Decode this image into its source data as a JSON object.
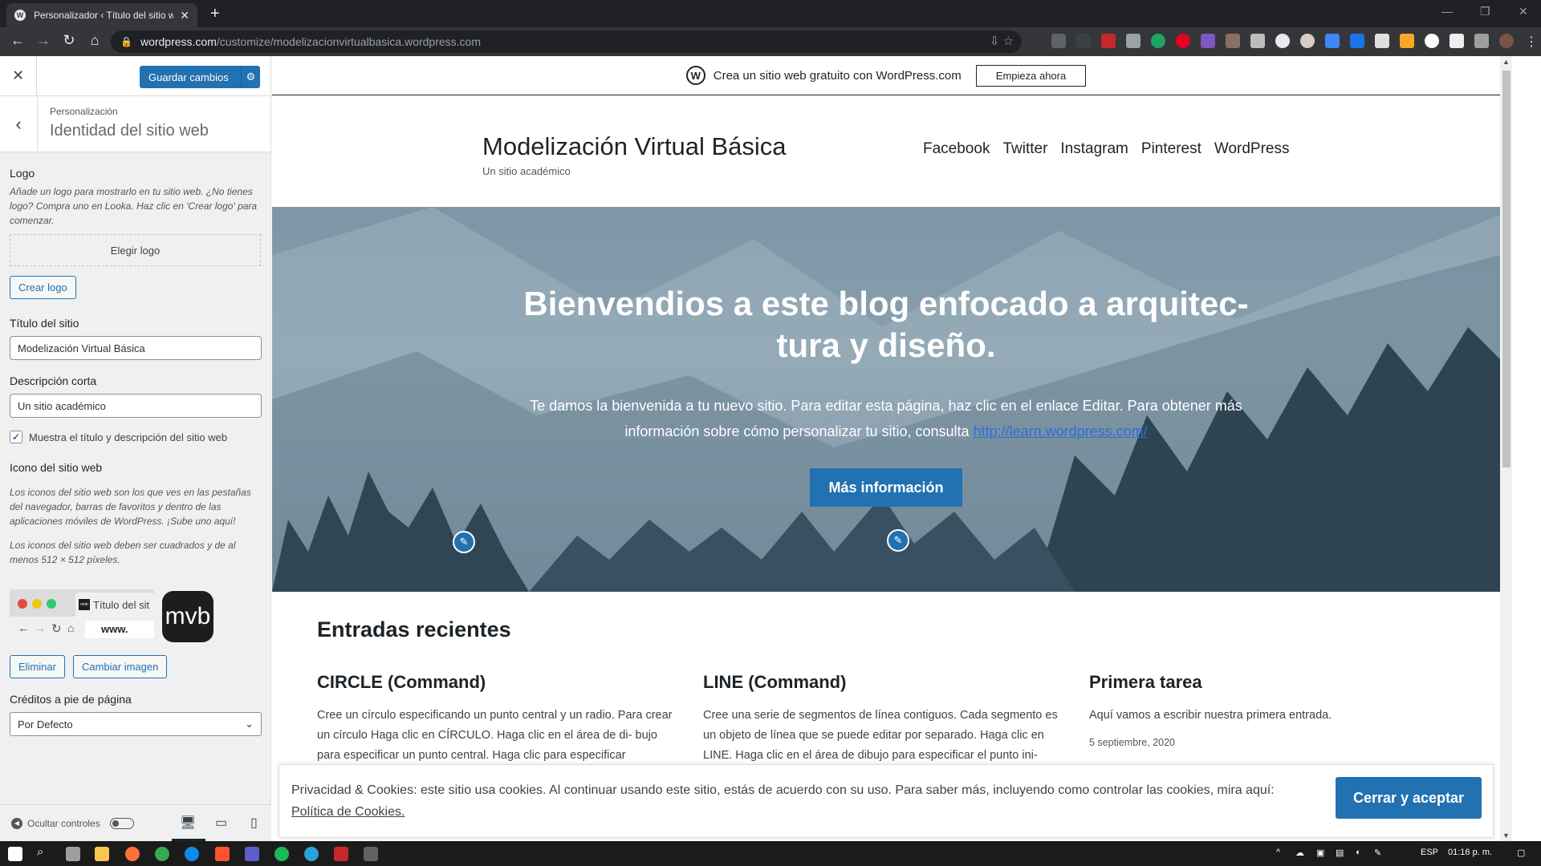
{
  "browser": {
    "tab_title": "Personalizador ‹ Título del sitio w",
    "tab_close": "✕",
    "new_tab": "+",
    "minimize": "—",
    "restore": "❐",
    "close": "✕",
    "url_host": "wordpress.com",
    "url_path": "/customize/modelizacionvirtualbasica.wordpress.com"
  },
  "customizer": {
    "close": "✕",
    "save_label": "Guardar cambios",
    "breadcrumb": "Personalización",
    "section_title": "Identidad del sitio web",
    "logo": {
      "label": "Logo",
      "description": "Añade un logo para mostrarlo en tu sitio web. ¿No tienes logo? Compra uno en Looka. Haz clic en 'Crear logo' para comenzar.",
      "choose": "Elegir logo",
      "create": "Crear logo"
    },
    "site_title": {
      "label": "Título del sitio",
      "value": "Modelización Virtual Básica"
    },
    "tagline": {
      "label": "Descripción corta",
      "value": "Un sitio académico"
    },
    "show_title_label": "Muestra el título y descripción del sitio web",
    "site_icon": {
      "label": "Icono del sitio web",
      "description1": "Los iconos del sitio web son los que ves en las pestañas del navegador, barras de favoritos y dentro de las aplicaciones móviles de WordPress. ¡Sube uno aquí!",
      "description2": "Los iconos del sitio web deben ser cuadrados y de al menos 512 × 512 píxeles.",
      "preview_tab": "Título del sit",
      "preview_url": "www.",
      "preview_icon_text": "mvb",
      "preview_favicon_text": "mvb",
      "remove": "Eliminar",
      "change": "Cambiar imagen"
    },
    "footer_credits": {
      "label": "Créditos a pie de página",
      "value": "Por Defecto"
    },
    "hide_controls": "Ocultar controles"
  },
  "site": {
    "banner_text": "Crea un sitio web gratuito con WordPress.com",
    "banner_button": "Empieza ahora",
    "title": "Modelización Virtual Básica",
    "tagline": "Un sitio académico",
    "nav": [
      "Facebook",
      "Twitter",
      "Instagram",
      "Pinterest",
      "WordPress"
    ],
    "hero": {
      "title": "Bienvendios a este blog enfocado a arquitec- tura y diseño.",
      "text": "Te damos la bienvenida a tu nuevo sitio. Para editar esta página, haz clic en el enlace Editar. Para obtener más información sobre cómo personalizar tu sitio, consulta",
      "link": "http://learn.wordpress.com/",
      "button": "Más información"
    },
    "recent_heading": "Entradas recientes",
    "posts": [
      {
        "title": "CIRCLE (Command)",
        "excerpt": "Cree un círculo especificando un punto central y un radio. Para crear un círculo Haga clic en CÍRCULO. Haga clic en el área de di- bujo para especificar un punto central. Haga clic para especificar"
      },
      {
        "title": "LINE (Command)",
        "excerpt": "Cree una serie de segmentos de línea contiguos. Cada segmento es un objeto de línea que se puede editar por separado. Haga clic en LINE. Haga clic en el área de dibujo para especificar el punto ini-"
      },
      {
        "title": "Primera tarea",
        "excerpt": "Aquí vamos a escribir nuestra primera entrada.",
        "date": "5 septiembre, 2020"
      }
    ],
    "cookie": {
      "text": "Privacidad & Cookies: este sitio usa cookies. Al continuar usando este sitio, estás de acuerdo con su uso. Para saber más, incluyendo como controlar las cookies, mira aquí:",
      "link": "Política de Cookies.",
      "button": "Cerrar y aceptar"
    }
  },
  "taskbar": {
    "language": "ESP",
    "time": "01:16 p. m."
  },
  "colors": {
    "accent": "#2271b1",
    "chrome_dark": "#202124"
  }
}
